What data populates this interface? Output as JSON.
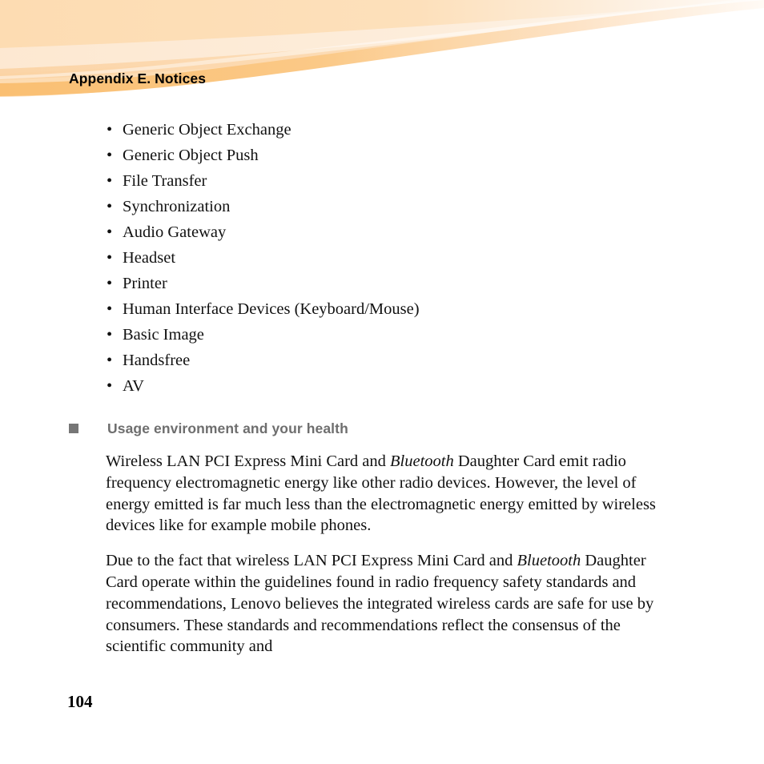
{
  "header": {
    "title": "Appendix E. Notices",
    "colors": {
      "banner_base": "#fddcb2",
      "swoosh_light": "#fde8d0",
      "swoosh_mid": "#fbd3a4",
      "band_dark": "#fabf72",
      "page_background": "#ffffff"
    }
  },
  "bullets": {
    "marker": "•",
    "items": [
      "Generic Object Exchange",
      "Generic Object Push",
      "File Transfer",
      "Synchronization",
      "Audio Gateway",
      "Headset",
      "Printer",
      "Human Interface Devices (Keyboard/Mouse)",
      "Basic Image",
      "Handsfree",
      "AV"
    ]
  },
  "section": {
    "heading": "Usage environment and your health",
    "heading_color": "#6e6e6e",
    "marker_color": "#767676"
  },
  "paragraphs": {
    "first": {
      "part1": "Wireless LAN PCI Express Mini Card and ",
      "italic1": "Bluetooth",
      "part2": " Daughter Card emit radio frequency electromagnetic energy like other radio devices. However, the level of energy emitted is far much less than the electromagnetic energy emitted by wireless devices like for example mobile phones."
    },
    "second": {
      "part1": "Due to the fact that wireless LAN PCI Express Mini Card and ",
      "italic1": "Bluetooth",
      "part2": " Daughter Card operate within the guidelines found in radio frequency safety standards and recommendations, Lenovo believes the integrated wireless cards are safe for use by consumers. These standards and recommendations reflect the consensus of the scientific community and"
    }
  },
  "footer": {
    "page_number": "104"
  }
}
